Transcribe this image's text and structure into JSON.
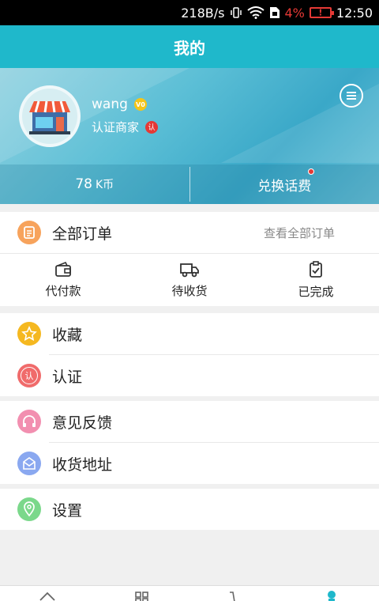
{
  "status_bar": {
    "speed": "218B/s",
    "battery_pct": "4%",
    "time": "12:50"
  },
  "title": "我的",
  "profile": {
    "username": "wang",
    "vip_badge": "V0",
    "merchant_label": "认证商家",
    "cert_badge": "认",
    "coins_value": "78",
    "coins_unit": "K币",
    "exchange_label": "兑换话费"
  },
  "orders": {
    "all_label": "全部订单",
    "view_all": "查看全部订单",
    "items": [
      {
        "label": "代付款"
      },
      {
        "label": "待收货"
      },
      {
        "label": "已完成"
      }
    ]
  },
  "menu1": [
    {
      "label": "收藏",
      "color": "#f5b820",
      "icon": "star-icon"
    },
    {
      "label": "认证",
      "color": "#f06b6b",
      "icon": "certify-icon",
      "glyph": "认"
    }
  ],
  "menu2": [
    {
      "label": "意见反馈",
      "color": "#f28fb0",
      "icon": "headphones-icon"
    },
    {
      "label": "收货地址",
      "color": "#8aa8f0",
      "icon": "address-icon"
    }
  ],
  "menu3": [
    {
      "label": "设置",
      "color": "#7bd88b",
      "icon": "location-icon"
    }
  ],
  "colors": {
    "primary": "#1fb8cb",
    "orders_icon": "#f7a35c"
  },
  "bottom_nav": [
    {
      "icon": "home-icon"
    },
    {
      "icon": "category-icon"
    },
    {
      "icon": "cart-icon"
    },
    {
      "icon": "profile-icon",
      "active": true
    }
  ]
}
